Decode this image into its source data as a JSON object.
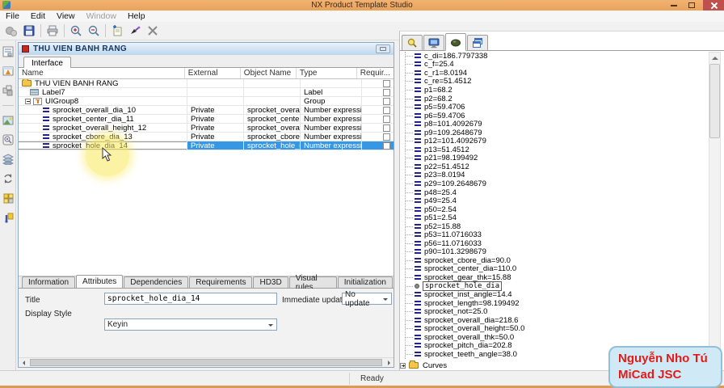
{
  "window": {
    "title": "NX Product Template Studio"
  },
  "menu": {
    "items": [
      {
        "label": "File"
      },
      {
        "label": "Edit"
      },
      {
        "label": "View"
      },
      {
        "label": "Window"
      },
      {
        "label": "Help"
      }
    ]
  },
  "toolbar": {
    "icons": [
      "gears-icon",
      "save-icon",
      "print-icon",
      "zoom-in-icon",
      "zoom-out-icon",
      "new-item-icon",
      "wand-icon",
      "delete-icon"
    ]
  },
  "left_toolbar": {
    "icons": [
      "form-icon",
      "dialog-icon",
      "blocks-icon",
      "image-icon",
      "zoom-box-icon",
      "layers-icon",
      "refresh-icon",
      "grid-blocks-icon",
      "pin-icon"
    ]
  },
  "template_window": {
    "title": "THU VIEN BANH RANG",
    "tab": "Interface",
    "columns": [
      "Name",
      "External",
      "Object Name",
      "Type",
      "Requir..."
    ],
    "rows": [
      {
        "name": "THU VIEN BANH RANG",
        "external": "",
        "object": "",
        "type": ""
      },
      {
        "name": "Label7",
        "external": "",
        "object": "",
        "type": "Label"
      },
      {
        "name": "UIGroup8",
        "external": "",
        "object": "",
        "type": "Group"
      },
      {
        "name": "sprocket_overall_dia_10",
        "external": "Private",
        "object": "sprocket_overall_dia",
        "type": "Number expression"
      },
      {
        "name": "sprocket_center_dia_11",
        "external": "Private",
        "object": "sprocket_center_dia",
        "type": "Number expression"
      },
      {
        "name": "sprocket_overall_height_12",
        "external": "Private",
        "object": "sprocket_overall_h...",
        "type": "Number expression"
      },
      {
        "name": "sprocket_cbore_dia_13",
        "external": "Private",
        "object": "sprocket_cbore_dia",
        "type": "Number expression"
      },
      {
        "name": "sprocket_hole_dia_14",
        "external": "Private",
        "object": "sprocket_hole_dia",
        "type": "Number expression"
      }
    ],
    "bottom_tabs": [
      "Information",
      "Attributes",
      "Dependencies",
      "Requirements",
      "HD3D",
      "Visual rules",
      "Initialization"
    ],
    "active_bottom_tab": "Attributes",
    "form": {
      "title_label": "Title",
      "title_value": "sprocket_hole_dia_14",
      "immediate_update_label": "Immediate update",
      "immediate_update_value": "No update",
      "display_style_label": "Display Style",
      "display_style_value": "Keyin"
    }
  },
  "expressions": {
    "tab_icons": [
      "search-tab-icon",
      "monitor-tab-icon",
      "mouse-tab-icon",
      "windows-tab-icon"
    ],
    "items": [
      {
        "t": "c_di=186.7797338"
      },
      {
        "t": "c_f=25.4"
      },
      {
        "t": "c_r1=8.0194"
      },
      {
        "t": "c_re=51.4512"
      },
      {
        "t": "p1=68.2"
      },
      {
        "t": "p2=68.2"
      },
      {
        "t": "p5=59.4706"
      },
      {
        "t": "p6=59.4706"
      },
      {
        "t": "p8=101.4092679"
      },
      {
        "t": "p9=109.2648679"
      },
      {
        "t": "p12=101.4092679"
      },
      {
        "t": "p13=51.4512"
      },
      {
        "t": "p21=98.199492"
      },
      {
        "t": "p22=51.4512"
      },
      {
        "t": "p23=8.0194"
      },
      {
        "t": "p29=109.2648679"
      },
      {
        "t": "p48=25.4"
      },
      {
        "t": "p49=25.4"
      },
      {
        "t": "p50=2.54"
      },
      {
        "t": "p51=2.54"
      },
      {
        "t": "p52=15.88"
      },
      {
        "t": "p53=11.0716033"
      },
      {
        "t": "p56=11.0716033"
      },
      {
        "t": "p90=101.3298679"
      },
      {
        "t": "sprocket_cbore_dia=90.0"
      },
      {
        "t": "sprocket_center_dia=110.0"
      },
      {
        "t": "sprocket_gear_thk=15.88"
      },
      {
        "t": "sprocket_hole_dia",
        "boxed": true
      },
      {
        "t": "sprocket_inst_angle=14.4"
      },
      {
        "t": "sprocket_length=98.199492"
      },
      {
        "t": "sprocket_not=25.0"
      },
      {
        "t": "sprocket_overall_dia=218.6"
      },
      {
        "t": "sprocket_overall_height=50.0"
      },
      {
        "t": "sprocket_overall_thk=50.0"
      },
      {
        "t": "sprocket_pitch_dia=202.8"
      },
      {
        "t": "sprocket_teeth_angle=38.0"
      }
    ],
    "folder_label": "Curves"
  },
  "status": {
    "text": "Ready"
  },
  "watermark": {
    "line1": "Nguyễn Nho Tú",
    "line2": "MiCad JSC"
  },
  "colors": {
    "selection": "#3797e4",
    "titlebar": "#eda766",
    "watermark_text": "#e51b15"
  }
}
